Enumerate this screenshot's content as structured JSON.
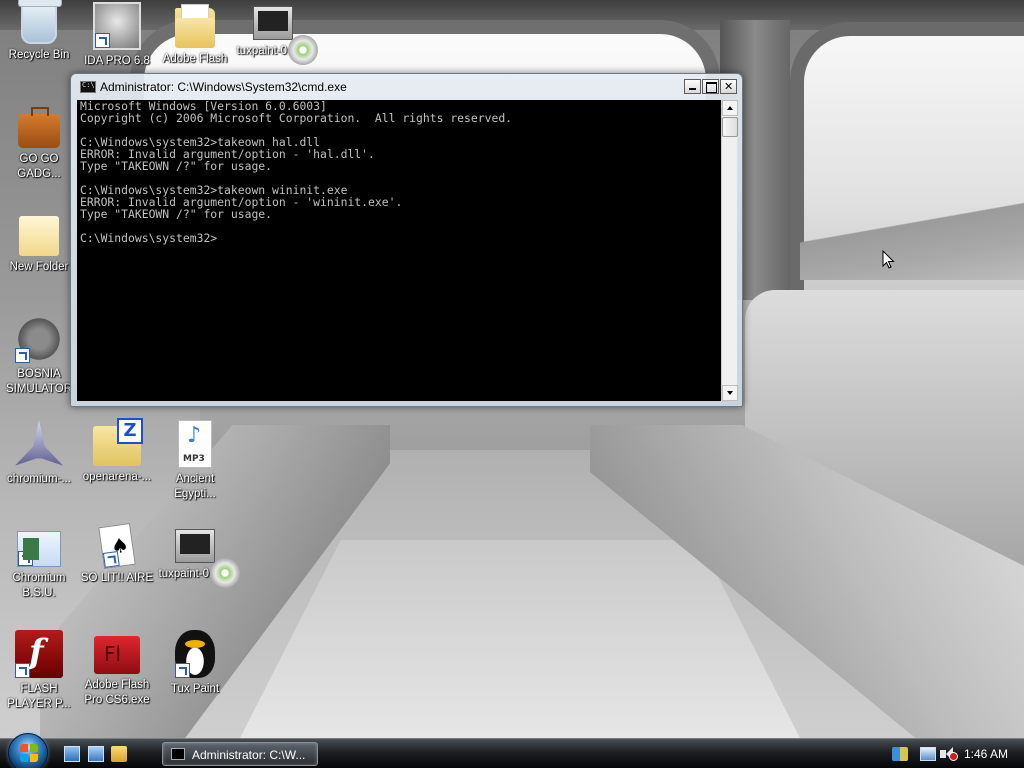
{
  "desktop": {
    "icons": [
      {
        "label": "Recycle Bin",
        "icon": "recycle-bin-icon"
      },
      {
        "label": "IDA PRO 6.8",
        "icon": "ida-pro-icon"
      },
      {
        "label": "Adobe Flash",
        "icon": "folder-icon"
      },
      {
        "label": "tuxpaint-0.9....",
        "icon": "installer-icon"
      },
      {
        "label": "GO GO GADG...",
        "icon": "briefcase-icon"
      },
      {
        "label": "New Folder",
        "icon": "folder-icon"
      },
      {
        "label": "BOSNIA SIMULATOR",
        "icon": "mine-icon"
      },
      {
        "label": "chromium-...",
        "icon": "spaceship-icon"
      },
      {
        "label": "openarena-...",
        "icon": "zip-folder-icon"
      },
      {
        "label": "Ancient Egypti...",
        "icon": "mp3-file-icon"
      },
      {
        "label": "Chromium B.S.U.",
        "icon": "web-page-icon"
      },
      {
        "label": "SO LIT!! AIRE",
        "icon": "solitaire-icon"
      },
      {
        "label": "tuxpaint-0.9....",
        "icon": "installer-icon"
      },
      {
        "label": "FLASH PLAYER P...",
        "icon": "flash-player-icon"
      },
      {
        "label": "Adobe Flash Pro CS6.exe",
        "icon": "flash-pro-icon"
      },
      {
        "label": "Tux Paint",
        "icon": "tux-icon"
      }
    ]
  },
  "cmd_window": {
    "title": "Administrator: C:\\Windows\\System32\\cmd.exe",
    "buttons": {
      "minimize": "minimize",
      "maximize": "maximize",
      "close": "close"
    },
    "console_lines": [
      "Microsoft Windows [Version 6.0.6003]",
      "Copyright (c) 2006 Microsoft Corporation.  All rights reserved.",
      "",
      "C:\\Windows\\system32>takeown hal.dll",
      "ERROR: Invalid argument/option - 'hal.dll'.",
      "Type \"TAKEOWN /?\" for usage.",
      "",
      "C:\\Windows\\system32>takeown wininit.exe",
      "ERROR: Invalid argument/option - 'wininit.exe'.",
      "Type \"TAKEOWN /?\" for usage.",
      "",
      "C:\\Windows\\system32>"
    ]
  },
  "taskbar": {
    "start_icon": "windows-start-orb-icon",
    "quick_launch": [
      "show-desktop-icon",
      "switch-windows-icon",
      "explorer-icon"
    ],
    "task_button_label": "Administrator: C:\\W...",
    "clock": "1:46 AM",
    "tray_icons": [
      "windows-flag-icon",
      "network-icon",
      "volume-muted-icon"
    ]
  },
  "colors": {
    "console_bg": "#000000",
    "console_text": "#c0c0c0",
    "label_text": "#ffffff"
  }
}
